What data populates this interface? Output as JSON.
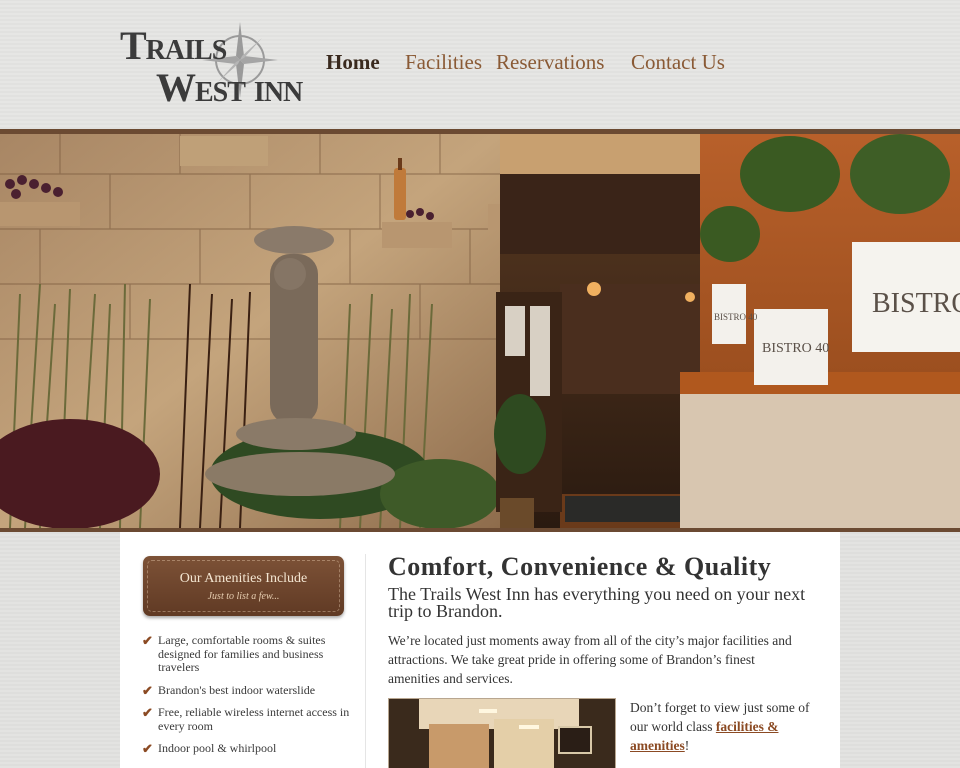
{
  "logo": {
    "line1": "Trails",
    "line2": "West inn"
  },
  "nav": {
    "items": [
      {
        "label": "Home"
      },
      {
        "label": "Facilities"
      },
      {
        "label": "Reservations"
      },
      {
        "label": "Contact Us"
      }
    ]
  },
  "hero": {
    "sign_large": "BISTRO",
    "sign_small_1": "BISTRO 40",
    "sign_small_2": "BISTRO 40"
  },
  "amenities": {
    "title": "Our Amenities Include",
    "subtitle": "Just to list a few...",
    "items": [
      "Large, comfortable rooms & suites designed for families and business travelers",
      "Brandon's best indoor waterslide",
      "Free, reliable wireless internet access in every room",
      "Indoor pool & whirlpool"
    ]
  },
  "main": {
    "title": "Comfort, Convenience & Quality",
    "subtitle": "The Trails West Inn has everything you need on your next trip to Brandon.",
    "paragraph": "We’re located just moments away from all of the city’s major facilities and attractions. We take great pride in offering some of Brandon’s finest amenities and services.",
    "note_prefix": "Don’t forget to view just some of our world class ",
    "note_link": "facilities & amenities",
    "note_suffix": "!"
  },
  "colors": {
    "accent_brown": "#8b4a23",
    "nav_brown": "#8a5a35",
    "rule_brown": "#6b4a32"
  }
}
